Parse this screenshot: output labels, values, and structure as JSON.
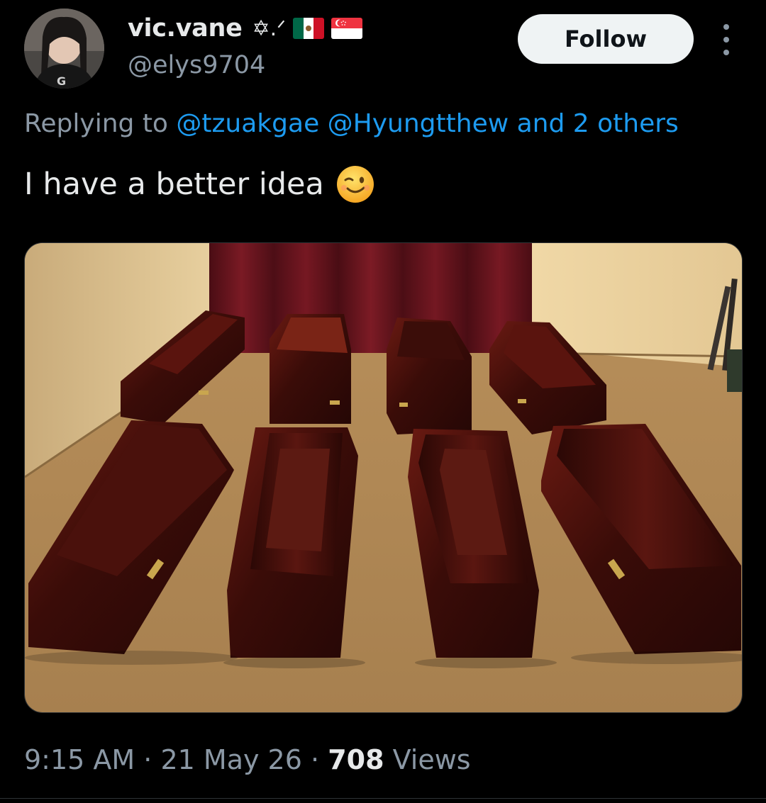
{
  "author": {
    "display_name": "vic.vane",
    "name_decoration": "✡.ᐟ",
    "handle": "@elys9704",
    "avatar_icon": "profile-photo-icon",
    "flags": [
      "mexico-flag-icon",
      "singapore-flag-icon"
    ]
  },
  "follow_label": "Follow",
  "more_icon": "more-options-icon",
  "reply": {
    "prefix": "Replying to",
    "mentions": [
      "@tzuakgae",
      "@Hyungtthew"
    ],
    "suffix": "and 2 others"
  },
  "tweet": {
    "text": "I have a better idea",
    "emoji": "winking-face-icon"
  },
  "media": {
    "icon": "photo-of-coffins-icon"
  },
  "meta": {
    "time": "9:15 AM",
    "separator": "·",
    "date": "21 May 26",
    "views_count": "708",
    "views_label": "Views"
  },
  "colors": {
    "background": "#000000",
    "text": "#e7e9ea",
    "secondary": "#8b98a5",
    "link": "#1d9bf0",
    "follow_bg": "#eff3f4"
  }
}
